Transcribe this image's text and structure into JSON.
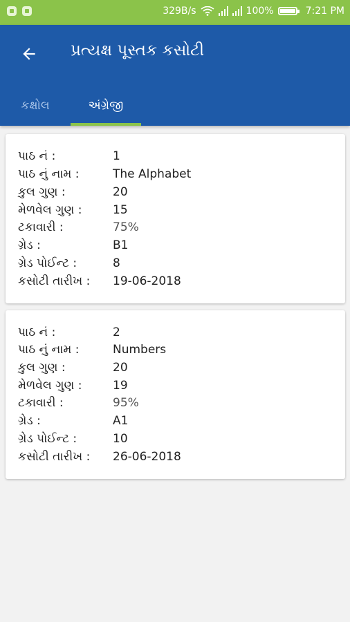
{
  "status_bar": {
    "speed": "329B/s",
    "battery": "100%",
    "time": "7:21 PM",
    "icons": [
      "notification-icon",
      "app-icon",
      "wifi-icon",
      "signal-icon",
      "signal-icon",
      "battery-icon"
    ]
  },
  "app_bar": {
    "title": "પ્રત્યક્ષ પૂસ્તક કસોટી",
    "back_icon": "arrow-left-icon"
  },
  "tabs": [
    {
      "label": "કક્ષોલ",
      "active": false
    },
    {
      "label": "અંગ્રેજી",
      "active": true
    }
  ],
  "labels": {
    "lesson_no": "પાઠ નં :",
    "lesson_name": "પાઠ નું નામ :",
    "total_marks": "કુલ ગુણ :",
    "obtained_marks": "મેળવેલ ગુણ :",
    "percentage": "ટકાવારી :",
    "grade": "ગ્રેડ :",
    "grade_point": "ગ્રેડ પોઈન્ટ :",
    "test_date": "કસોટી તારીખ :"
  },
  "records": [
    {
      "lesson_no": "1",
      "lesson_name": "The Alphabet",
      "total_marks": "20",
      "obtained_marks": "15",
      "percentage": "75%",
      "grade": "B1",
      "grade_point": "8",
      "test_date": "19-06-2018"
    },
    {
      "lesson_no": "2",
      "lesson_name": "Numbers",
      "total_marks": "20",
      "obtained_marks": "19",
      "percentage": "95%",
      "grade": "A1",
      "grade_point": "10",
      "test_date": "26-06-2018"
    }
  ],
  "colors": {
    "status_bar": "#8bc34a",
    "app_bar": "#1e5aa8",
    "tab_indicator": "#8bc34a",
    "background": "#f2f2f2"
  }
}
